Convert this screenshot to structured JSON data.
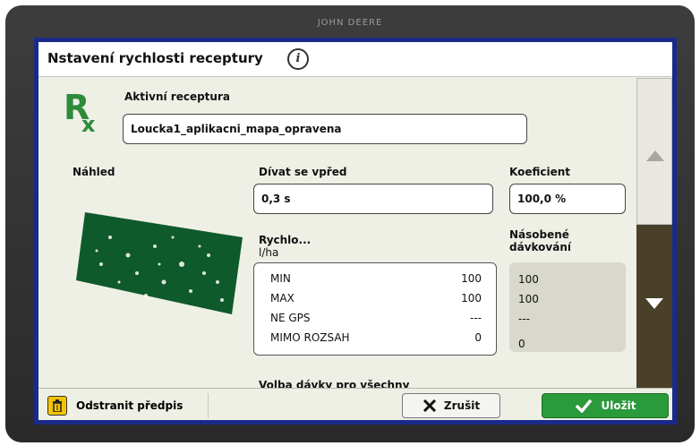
{
  "device": {
    "brand": "JOHN DEERE"
  },
  "dialog": {
    "title": "Nstavení rychlosti receptury"
  },
  "recipe": {
    "active_label": "Aktivní receptura",
    "active_value": "Loucka1_aplikacni_mapa_opravena",
    "icon": "rx-icon"
  },
  "preview": {
    "label": "Náhled"
  },
  "lookahead": {
    "label": "Dívat se vpřed",
    "value": "0,3 s"
  },
  "coefficient": {
    "label": "Koeficient",
    "value": "100,0 %"
  },
  "rates": {
    "label": "Rychlo...",
    "unit": "l/ha",
    "rows": [
      {
        "name": "MIN",
        "value": "100"
      },
      {
        "name": "MAX",
        "value": "100"
      },
      {
        "name": "NE GPS",
        "value": "---"
      },
      {
        "name": "MIMO ROZSAH",
        "value": "0"
      }
    ]
  },
  "multiplied": {
    "label_line1": "Násobené",
    "label_line2": "dávkování",
    "values": [
      "100",
      "100",
      "---",
      "0"
    ]
  },
  "cutoff_text": "Volba dávky pro všechny",
  "footer": {
    "delete_label": "Odstranit předpis",
    "cancel_label": "Zrušit",
    "save_label": "Uložit"
  },
  "colors": {
    "accent_green": "#2a9a3a",
    "rx_green": "#2e8b3a",
    "frame_blue": "#1a2a8a"
  }
}
